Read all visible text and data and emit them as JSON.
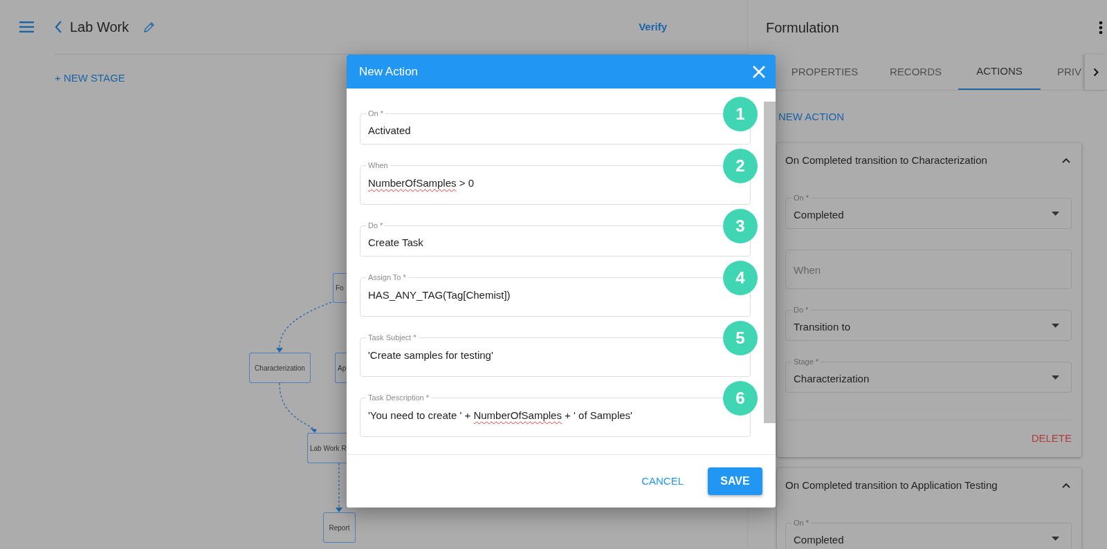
{
  "header": {
    "title": "Lab Work",
    "verify": "Verify"
  },
  "new_stage": "+ NEW STAGE",
  "diagram": {
    "nodes": [
      {
        "label": "Fo"
      },
      {
        "label": "Characterization"
      },
      {
        "label": "Ap"
      },
      {
        "label": "Lab Work R"
      },
      {
        "label": "Report"
      }
    ]
  },
  "dialog": {
    "title": "New Action",
    "fields": [
      {
        "label": "On *",
        "kind": "select",
        "value_parts": [
          {
            "text": "Activated",
            "misspelled": false
          }
        ],
        "badge": "1"
      },
      {
        "label": "When",
        "kind": "text",
        "value_parts": [
          {
            "text": "NumberOfSamples",
            "misspelled": true
          },
          {
            "text": " > 0",
            "misspelled": false
          }
        ],
        "badge": "2"
      },
      {
        "label": "Do *",
        "kind": "select",
        "value_parts": [
          {
            "text": "Create Task",
            "misspelled": false
          }
        ],
        "badge": "3"
      },
      {
        "label": "Assign To *",
        "kind": "text",
        "value_parts": [
          {
            "text": "HAS_ANY_TAG(Tag[Chemist])",
            "misspelled": false
          }
        ],
        "badge": "4"
      },
      {
        "label": "Task Subject *",
        "kind": "text",
        "value_parts": [
          {
            "text": "'Create samples for testing'",
            "misspelled": false
          }
        ],
        "badge": "5"
      },
      {
        "label": "Task Description *",
        "kind": "text",
        "value_parts": [
          {
            "text": "'You need to create ' + ",
            "misspelled": false
          },
          {
            "text": "NumberOfSamples",
            "misspelled": true
          },
          {
            "text": " + ' of Samples'",
            "misspelled": false
          }
        ],
        "badge": "6"
      }
    ],
    "buttons": [
      {
        "label": "CANCEL",
        "kind": "text"
      },
      {
        "label": "SAVE",
        "kind": "contained"
      }
    ]
  },
  "panel": {
    "title": "Formulation",
    "tabs": [
      {
        "label": "PROPERTIES",
        "selected": false
      },
      {
        "label": "RECORDS",
        "selected": false
      },
      {
        "label": "ACTIONS",
        "selected": true
      },
      {
        "label": "PRIV",
        "selected": false
      }
    ],
    "new_action": "NEW ACTION",
    "actions": [
      {
        "title": "On Completed transition to Characterization",
        "expanded": true,
        "fields": [
          {
            "label": "On *",
            "kind": "select",
            "value": "Completed"
          },
          {
            "kind": "text",
            "placeholder": "When"
          },
          {
            "label": "Do *",
            "kind": "select",
            "value": "Transition to"
          },
          {
            "label": "Stage *",
            "kind": "select",
            "value": "Characterization"
          }
        ],
        "delete": "DELETE"
      },
      {
        "title": "On Completed transition to Application Testing",
        "expanded": true,
        "fields": [
          {
            "label": "On *",
            "kind": "select",
            "value": "Completed"
          }
        ]
      }
    ]
  }
}
